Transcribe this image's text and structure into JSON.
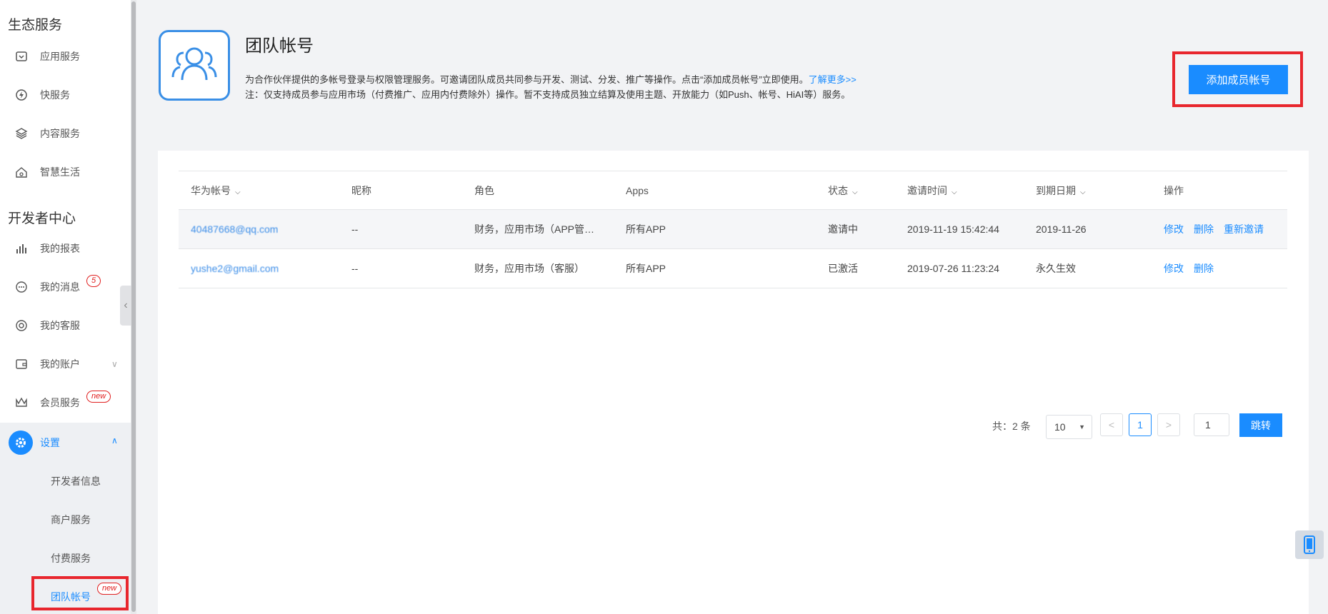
{
  "sidebar": {
    "section_eco": "生态服务",
    "eco_items": [
      {
        "label": "应用服务",
        "icon": "app-service-icon"
      },
      {
        "label": "快服务",
        "icon": "quick-service-icon"
      },
      {
        "label": "内容服务",
        "icon": "layers-icon"
      },
      {
        "label": "智慧生活",
        "icon": "smart-home-icon"
      }
    ],
    "section_dev": "开发者中心",
    "dev_items": [
      {
        "label": "我的报表",
        "icon": "bar-chart-icon"
      },
      {
        "label": "我的消息",
        "icon": "message-icon",
        "badge": "5"
      },
      {
        "label": "我的客服",
        "icon": "headset-icon"
      },
      {
        "label": "我的账户",
        "icon": "wallet-icon"
      },
      {
        "label": "会员服务",
        "icon": "crown-icon",
        "badge": "new"
      }
    ],
    "settings_label": "设置",
    "settings_sub": [
      {
        "label": "开发者信息"
      },
      {
        "label": "商户服务"
      },
      {
        "label": "付费服务"
      },
      {
        "label": "团队帐号",
        "badge": "new"
      }
    ]
  },
  "header": {
    "title": "团队帐号",
    "desc_line1": "为合作伙伴提供的多帐号登录与权限管理服务。可邀请团队成员共同参与开发、测试、分发、推广等操作。点击“添加成员帐号”立即使用。",
    "learn_more": "了解更多>>",
    "desc_line2": "注：仅支持成员参与应用市场（付费推广、应用内付费除外）操作。暂不支持成员独立结算及使用主题、开放能力（如Push、帐号、HiAI等）服务。",
    "add_button": "添加成员帐号"
  },
  "table": {
    "columns": [
      "华为帐号",
      "昵称",
      "角色",
      "Apps",
      "状态",
      "邀请时间",
      "到期日期",
      "操作"
    ],
    "rows": [
      {
        "account": "40487668@qq.com",
        "nickname": "--",
        "role": "财务，应用市场（APP管…",
        "apps": "所有APP",
        "status": "邀请中",
        "invite_time": "2019-11-19 15:42:44",
        "expire": "2019-11-26",
        "ops": [
          "修改",
          "删除",
          "重新邀请"
        ]
      },
      {
        "account": "yushe2@gmail.com",
        "nickname": "--",
        "role": "财务，应用市场（客服）",
        "apps": "所有APP",
        "status": "已激活",
        "invite_time": "2019-07-26 11:23:24",
        "expire": "永久生效",
        "ops": [
          "修改",
          "删除"
        ]
      }
    ]
  },
  "pagination": {
    "total": "共：2 条",
    "page_size": "10",
    "prev": "<",
    "current_page": "1",
    "next": ">",
    "jump_value": "1",
    "jump_button": "跳转"
  },
  "colors": {
    "accent": "#1a8cff",
    "highlight": "#e8262d"
  }
}
